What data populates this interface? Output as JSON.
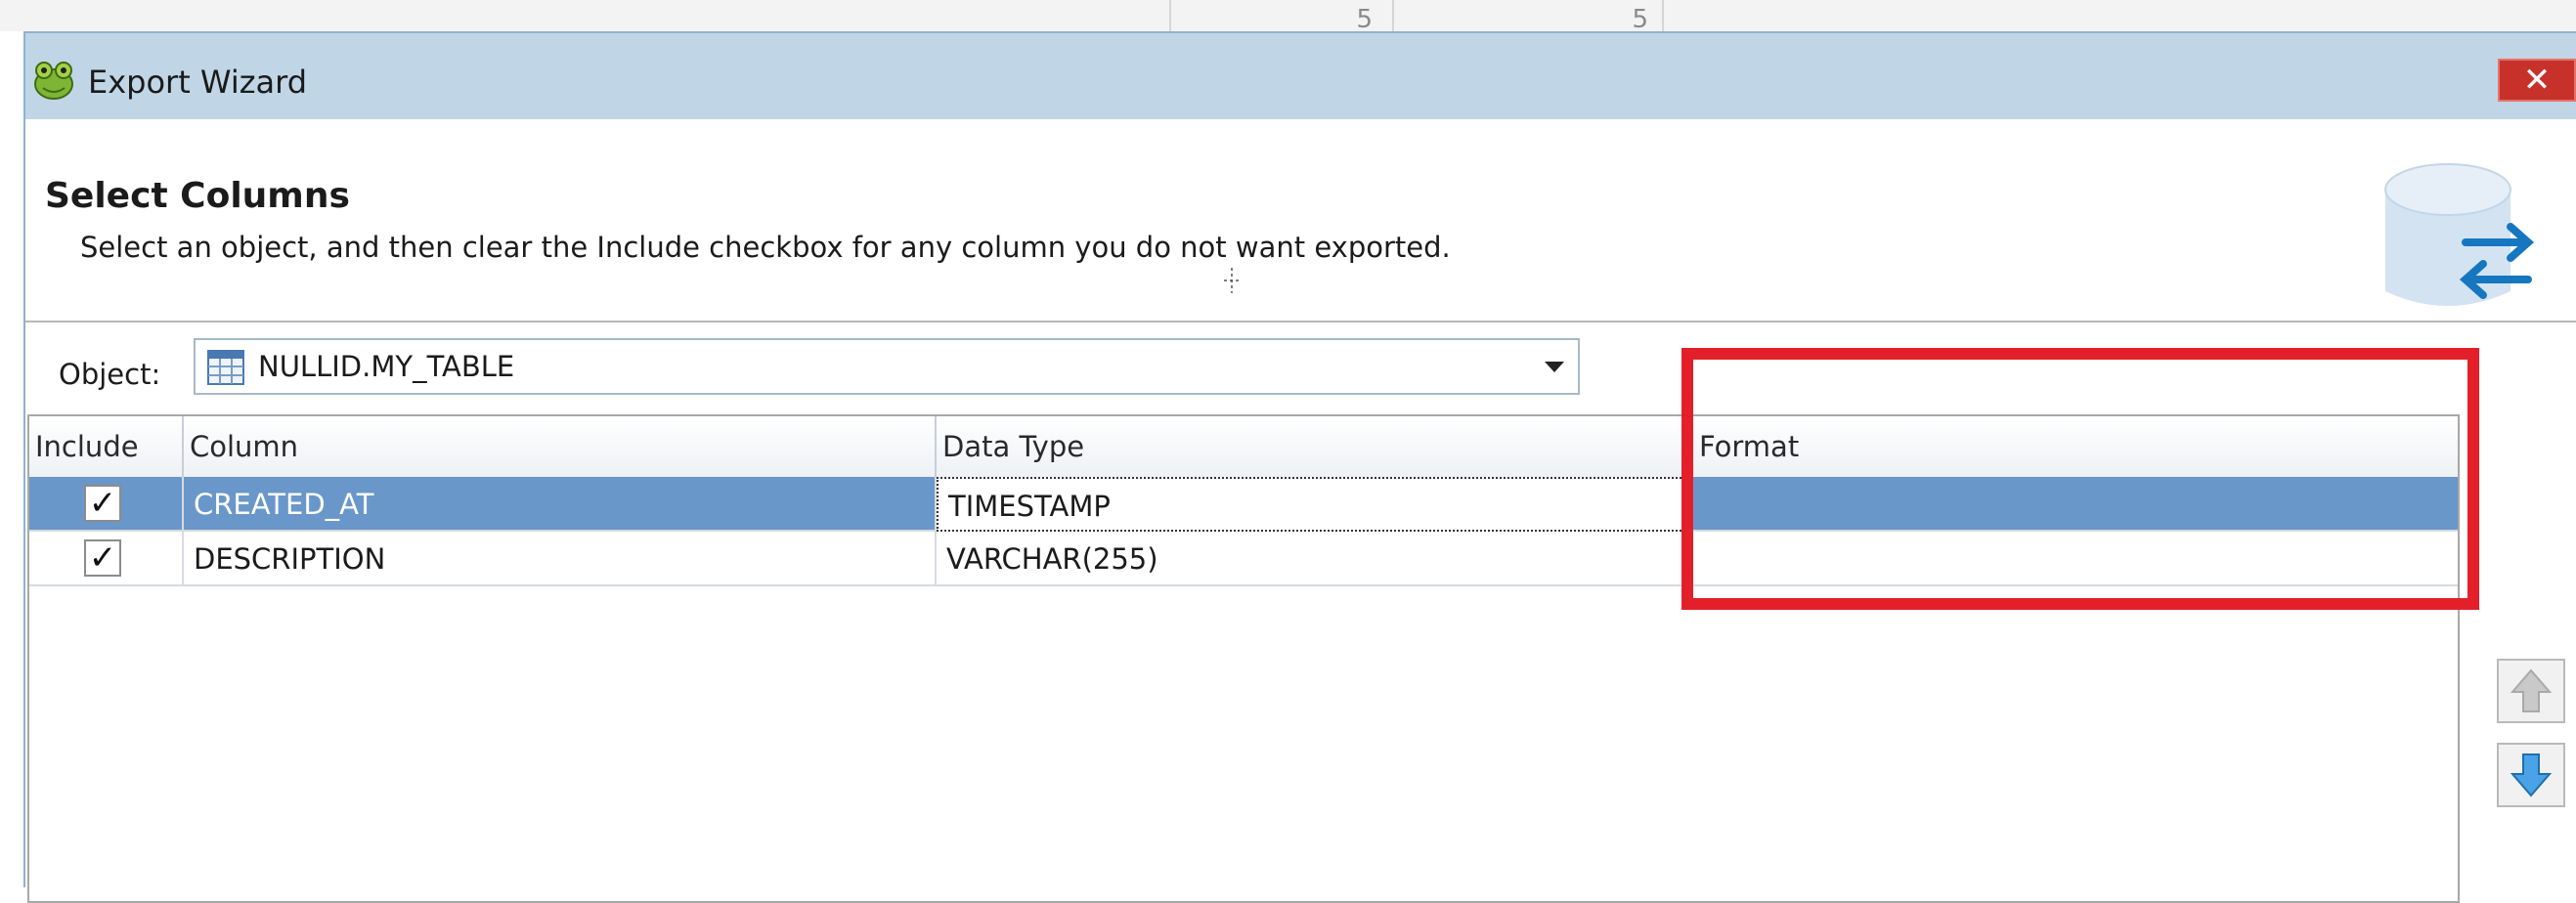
{
  "background": {
    "cells": [
      "5",
      "5"
    ]
  },
  "window": {
    "title": "Export Wizard",
    "close_glyph": "✕",
    "app_icon": "frog-icon"
  },
  "header": {
    "title": "Select Columns",
    "description": "Select an object, and then clear the Include checkbox for any column you do not want exported.",
    "icon": "database-export-icon"
  },
  "object": {
    "label": "Object:",
    "value": "NULLID.MY_TABLE",
    "icon": "table-icon"
  },
  "grid": {
    "columns": [
      "Include",
      "Column",
      "Data Type",
      "Format"
    ],
    "rows": [
      {
        "include": true,
        "column": "CREATED_AT",
        "data_type": "TIMESTAMP",
        "format": "",
        "selected": true
      },
      {
        "include": true,
        "column": "DESCRIPTION",
        "data_type": "VARCHAR(255)",
        "format": "",
        "selected": false
      }
    ]
  },
  "side_buttons": [
    "move-up-arrow-icon",
    "move-down-arrow-icon"
  ],
  "colors": {
    "titlebar": "#c0d6e6",
    "selected_row": "#6a97c9",
    "highlight": "#e3202a",
    "close": "#c7312a"
  }
}
